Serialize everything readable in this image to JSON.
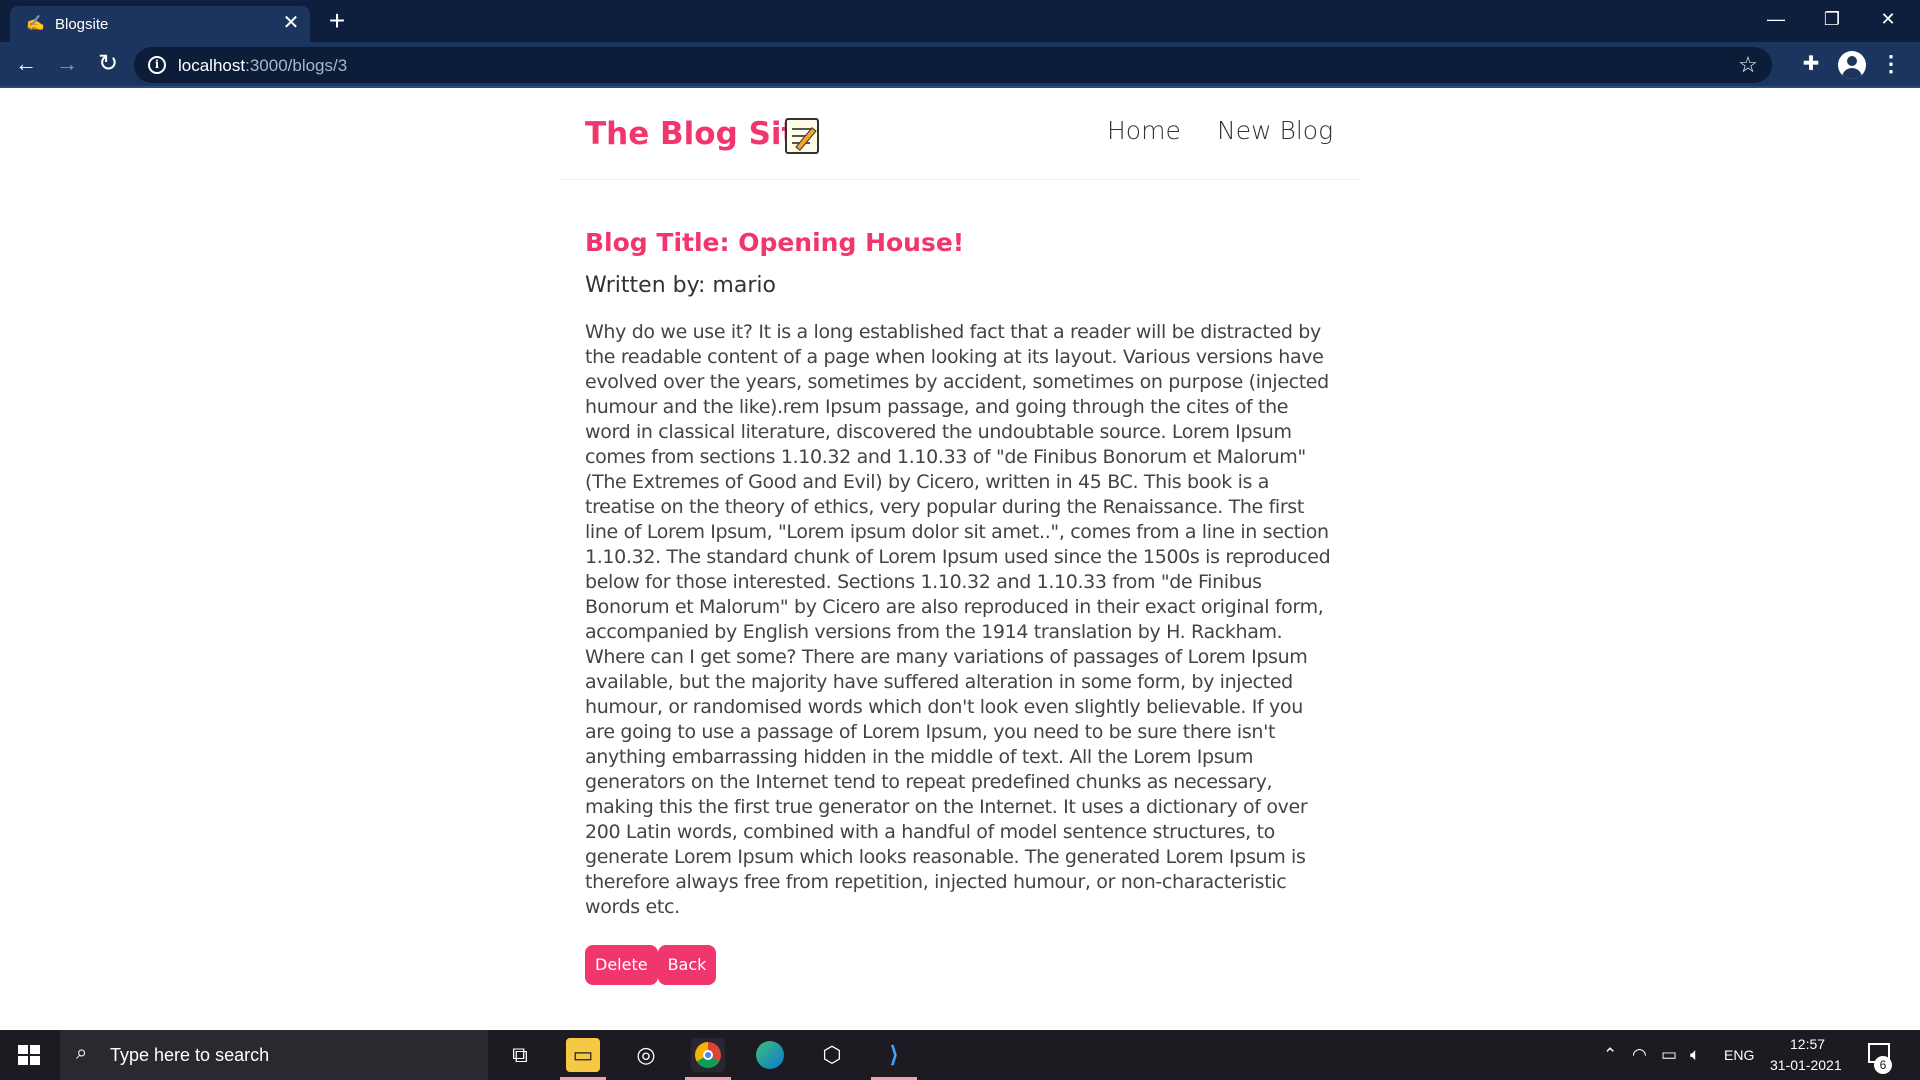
{
  "browser": {
    "tab_title": "Blogsite",
    "tab_close": "✕",
    "new_tab": "+",
    "url_host": "localhost",
    "url_path": ":3000/blogs/3"
  },
  "site": {
    "brand": "The Blog Site",
    "nav": {
      "home": "Home",
      "new_blog": "New Blog"
    }
  },
  "blog": {
    "title": "Blog Title: Opening House!",
    "author": "Written by: mario",
    "body": "Why do we use it? It is a long established fact that a reader will be distracted by the readable content of a page when looking at its layout. Various versions have evolved over the years, sometimes by accident, sometimes on purpose (injected humour and the like).rem Ipsum passage, and going through the cites of the word in classical literature, discovered the undoubtable source. Lorem Ipsum comes from sections 1.10.32 and 1.10.33 of \"de Finibus Bonorum et Malorum\" (The Extremes of Good and Evil) by Cicero, written in 45 BC. This book is a treatise on the theory of ethics, very popular during the Renaissance. The first line of Lorem Ipsum, \"Lorem ipsum dolor sit amet..\", comes from a line in section 1.10.32. The standard chunk of Lorem Ipsum used since the 1500s is reproduced below for those interested. Sections 1.10.32 and 1.10.33 from \"de Finibus Bonorum et Malorum\" by Cicero are also reproduced in their exact original form, accompanied by English versions from the 1914 translation by H. Rackham. Where can I get some? There are many variations of passages of Lorem Ipsum available, but the majority have suffered alteration in some form, by injected humour, or randomised words which don't look even slightly believable. If you are going to use a passage of Lorem Ipsum, you need to be sure there isn't anything embarrassing hidden in the middle of text. All the Lorem Ipsum generators on the Internet tend to repeat predefined chunks as necessary, making this the first true generator on the Internet. It uses a dictionary of over 200 Latin words, combined with a handful of model sentence structures, to generate Lorem Ipsum which looks reasonable. The generated Lorem Ipsum is therefore always free from repetition, injected humour, or non-characteristic words etc.",
    "delete_label": "Delete",
    "back_label": "Back"
  },
  "taskbar": {
    "search_placeholder": "Type here to search",
    "language": "ENG",
    "time": "12:57",
    "date": "31-01-2021",
    "notification_count": "6"
  },
  "colors": {
    "accent": "#f1356d",
    "browser_frame": "#0d1f3c",
    "browser_toolbar": "#1c355e",
    "taskbar": "#1d1a22"
  },
  "icons": [
    "browser-favicon-icon",
    "close-icon",
    "plus-icon",
    "minimize-icon",
    "maximize-icon",
    "back-arrow-icon",
    "forward-arrow-icon",
    "reload-icon",
    "site-info-icon",
    "bookmark-star-icon",
    "extensions-puzzle-icon",
    "profile-icon",
    "more-menu-icon",
    "memo-emoji-icon",
    "windows-start-icon",
    "search-icon",
    "task-view-icon",
    "file-explorer-icon",
    "cortana-icon",
    "chrome-icon",
    "edge-icon",
    "unity-icon",
    "vscode-icon",
    "chevron-up-icon",
    "wifi-icon",
    "battery-icon",
    "volume-icon",
    "notification-icon"
  ]
}
